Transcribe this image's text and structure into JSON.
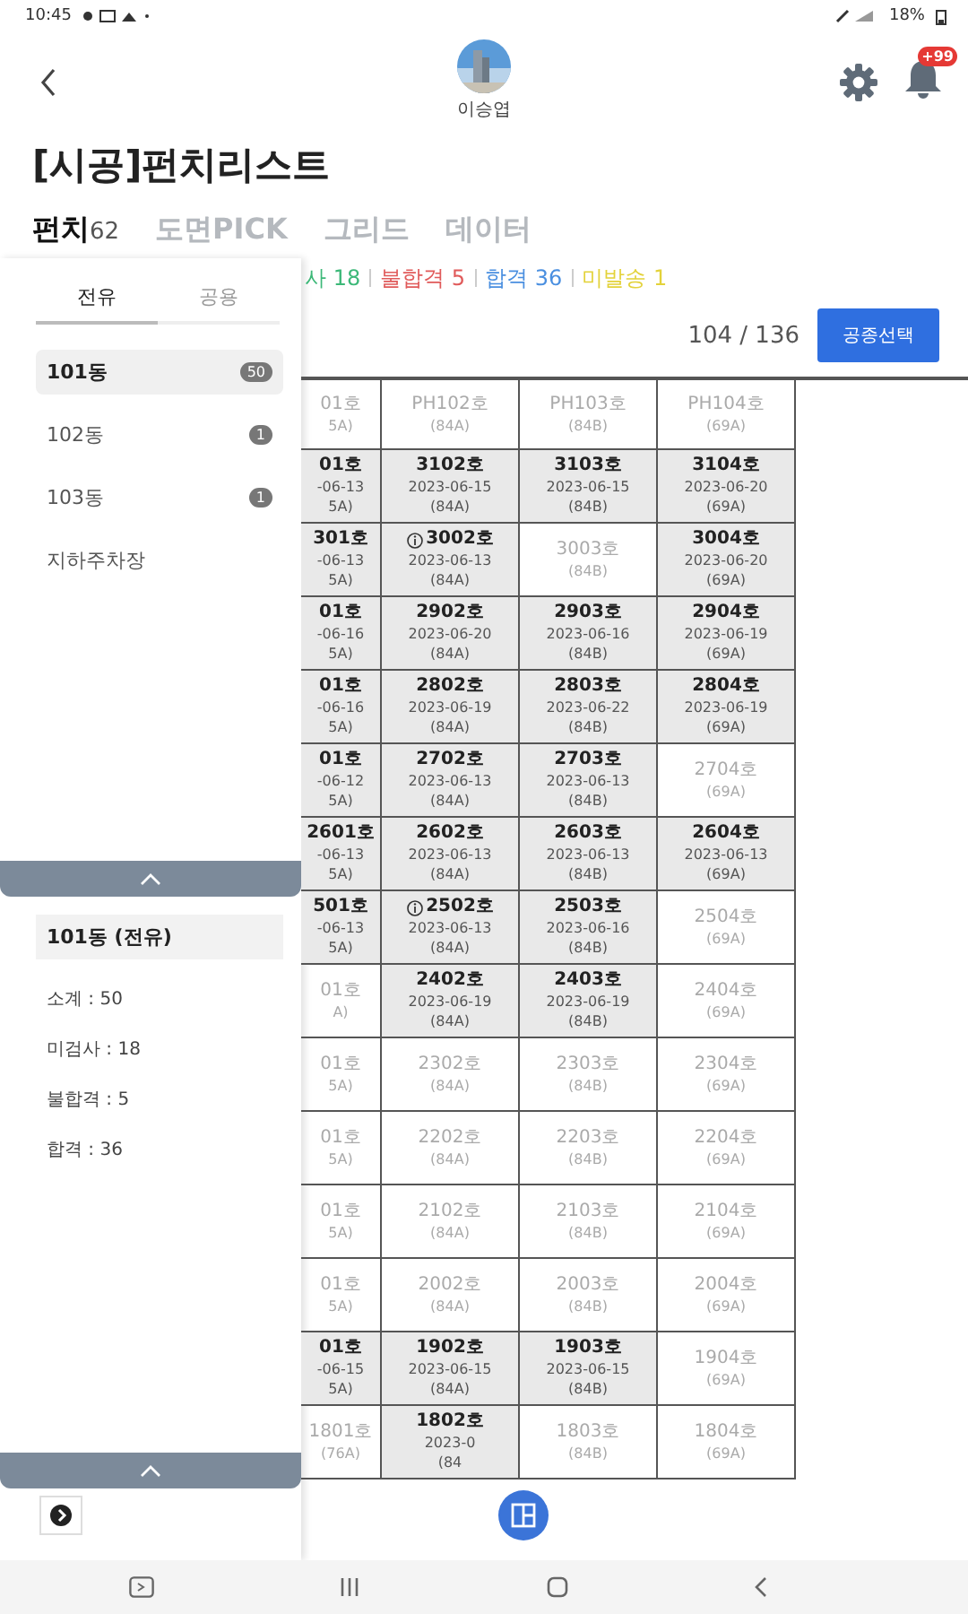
{
  "status_bar": {
    "time": "10:45",
    "battery": "18%"
  },
  "header": {
    "user_name": "이승엽",
    "notification_badge": "+99"
  },
  "title": "[시공]펀치리스트",
  "tabs": [
    {
      "label": "펀치",
      "count": "62",
      "selected": true
    },
    {
      "label": "도면PICK",
      "selected": false
    },
    {
      "label": "그리드",
      "selected": false
    },
    {
      "label": "데이터",
      "selected": false
    }
  ],
  "sidebar": {
    "segments": [
      {
        "label": "전유",
        "selected": true
      },
      {
        "label": "공용",
        "selected": false
      }
    ],
    "items": [
      {
        "label": "101동",
        "badge": "50",
        "selected": true
      },
      {
        "label": "102동",
        "badge": "1",
        "selected": false
      },
      {
        "label": "103동",
        "badge": "1",
        "selected": false
      },
      {
        "label": "지하주차장",
        "selected": false
      }
    ],
    "summary": {
      "title": "101동 (전유)",
      "lines": [
        "소계 : 50",
        "미검사 : 18",
        "불합격 : 5",
        "합격 : 36"
      ]
    }
  },
  "legend": [
    {
      "label": "사 18",
      "color": "#3cb878"
    },
    {
      "label": "불합격 5",
      "color": "#e05a5a"
    },
    {
      "label": "합격 36",
      "color": "#4a8fe0"
    },
    {
      "label": "미발송 1",
      "color": "#e3d23a"
    }
  ],
  "progress_text": "104 / 136",
  "select_button": "공종선택",
  "grid": {
    "rows": [
      [
        {
          "unit": "01호",
          "type": "5A)",
          "inspected": false
        },
        {
          "unit": "PH102호",
          "type": "(84A)",
          "inspected": false
        },
        {
          "unit": "PH103호",
          "type": "(84B)",
          "inspected": false
        },
        {
          "unit": "PH104호",
          "type": "(69A)",
          "inspected": false
        }
      ],
      [
        {
          "unit": "01호",
          "date": "-06-13",
          "type": "5A)",
          "inspected": true
        },
        {
          "unit": "3102호",
          "date": "2023-06-15",
          "type": "(84A)",
          "inspected": true
        },
        {
          "unit": "3103호",
          "date": "2023-06-15",
          "type": "(84B)",
          "inspected": true
        },
        {
          "unit": "3104호",
          "date": "2023-06-20",
          "type": "(69A)",
          "inspected": true
        }
      ],
      [
        {
          "unit": "301호",
          "date": "-06-13",
          "type": "5A)",
          "inspected": true
        },
        {
          "unit": "3002호",
          "date": "2023-06-13",
          "type": "(84A)",
          "inspected": true,
          "flagged": true
        },
        {
          "unit": "3003호",
          "type": "(84B)",
          "inspected": false
        },
        {
          "unit": "3004호",
          "date": "2023-06-20",
          "type": "(69A)",
          "inspected": true
        }
      ],
      [
        {
          "unit": "01호",
          "date": "-06-16",
          "type": "5A)",
          "inspected": true
        },
        {
          "unit": "2902호",
          "date": "2023-06-20",
          "type": "(84A)",
          "inspected": true
        },
        {
          "unit": "2903호",
          "date": "2023-06-16",
          "type": "(84B)",
          "inspected": true
        },
        {
          "unit": "2904호",
          "date": "2023-06-19",
          "type": "(69A)",
          "inspected": true
        }
      ],
      [
        {
          "unit": "01호",
          "date": "-06-16",
          "type": "5A)",
          "inspected": true
        },
        {
          "unit": "2802호",
          "date": "2023-06-19",
          "type": "(84A)",
          "inspected": true
        },
        {
          "unit": "2803호",
          "date": "2023-06-22",
          "type": "(84B)",
          "inspected": true
        },
        {
          "unit": "2804호",
          "date": "2023-06-19",
          "type": "(69A)",
          "inspected": true
        }
      ],
      [
        {
          "unit": "01호",
          "date": "-06-12",
          "type": "5A)",
          "inspected": true
        },
        {
          "unit": "2702호",
          "date": "2023-06-13",
          "type": "(84A)",
          "inspected": true
        },
        {
          "unit": "2703호",
          "date": "2023-06-13",
          "type": "(84B)",
          "inspected": true
        },
        {
          "unit": "2704호",
          "type": "(69A)",
          "inspected": false
        }
      ],
      [
        {
          "unit": "2601호",
          "date": "-06-13",
          "type": "5A)",
          "inspected": true
        },
        {
          "unit": "2602호",
          "date": "2023-06-13",
          "type": "(84A)",
          "inspected": true
        },
        {
          "unit": "2603호",
          "date": "2023-06-13",
          "type": "(84B)",
          "inspected": true
        },
        {
          "unit": "2604호",
          "date": "2023-06-13",
          "type": "(69A)",
          "inspected": true
        }
      ],
      [
        {
          "unit": "501호",
          "date": "-06-13",
          "type": "5A)",
          "inspected": true
        },
        {
          "unit": "2502호",
          "date": "2023-06-13",
          "type": "(84A)",
          "inspected": true,
          "flagged": true
        },
        {
          "unit": "2503호",
          "date": "2023-06-16",
          "type": "(84B)",
          "inspected": true
        },
        {
          "unit": "2504호",
          "type": "(69A)",
          "inspected": false
        }
      ],
      [
        {
          "unit": "01호",
          "type": "A)",
          "inspected": false
        },
        {
          "unit": "2402호",
          "date": "2023-06-19",
          "type": "(84A)",
          "inspected": true
        },
        {
          "unit": "2403호",
          "date": "2023-06-19",
          "type": "(84B)",
          "inspected": true
        },
        {
          "unit": "2404호",
          "type": "(69A)",
          "inspected": false
        }
      ],
      [
        {
          "unit": "01호",
          "type": "5A)",
          "inspected": false
        },
        {
          "unit": "2302호",
          "type": "(84A)",
          "inspected": false
        },
        {
          "unit": "2303호",
          "type": "(84B)",
          "inspected": false
        },
        {
          "unit": "2304호",
          "type": "(69A)",
          "inspected": false
        }
      ],
      [
        {
          "unit": "01호",
          "type": "5A)",
          "inspected": false
        },
        {
          "unit": "2202호",
          "type": "(84A)",
          "inspected": false
        },
        {
          "unit": "2203호",
          "type": "(84B)",
          "inspected": false
        },
        {
          "unit": "2204호",
          "type": "(69A)",
          "inspected": false
        }
      ],
      [
        {
          "unit": "01호",
          "type": "5A)",
          "inspected": false
        },
        {
          "unit": "2102호",
          "type": "(84A)",
          "inspected": false
        },
        {
          "unit": "2103호",
          "type": "(84B)",
          "inspected": false
        },
        {
          "unit": "2104호",
          "type": "(69A)",
          "inspected": false
        }
      ],
      [
        {
          "unit": "01호",
          "type": "5A)",
          "inspected": false
        },
        {
          "unit": "2002호",
          "type": "(84A)",
          "inspected": false
        },
        {
          "unit": "2003호",
          "type": "(84B)",
          "inspected": false
        },
        {
          "unit": "2004호",
          "type": "(69A)",
          "inspected": false
        }
      ],
      [
        {
          "unit": "01호",
          "date": "-06-15",
          "type": "5A)",
          "inspected": true
        },
        {
          "unit": "1902호",
          "date": "2023-06-15",
          "type": "(84A)",
          "inspected": true
        },
        {
          "unit": "1903호",
          "date": "2023-06-15",
          "type": "(84B)",
          "inspected": true
        },
        {
          "unit": "1904호",
          "type": "(69A)",
          "inspected": false
        }
      ],
      [
        {
          "unit": "1801호",
          "type": "(76A)",
          "inspected": false
        },
        {
          "unit": "1802호",
          "date": "2023-0",
          "type": "(84",
          "inspected": true
        },
        {
          "unit": "1803호",
          "type": "(84B)",
          "inspected": false
        },
        {
          "unit": "1804호",
          "type": "(69A)",
          "inspected": false
        }
      ]
    ]
  }
}
